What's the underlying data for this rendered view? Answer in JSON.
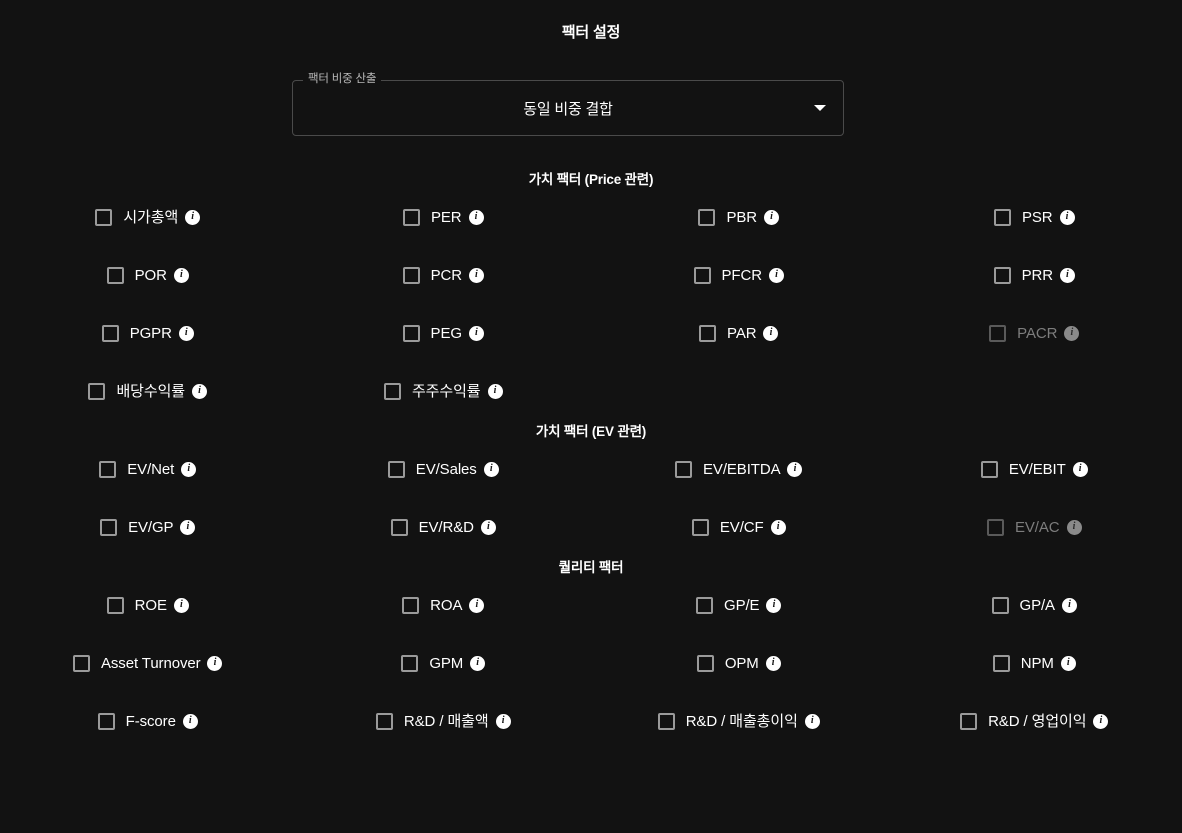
{
  "page": {
    "title": "팩터 설정",
    "background_color": "#121212",
    "text_color": "#ffffff",
    "disabled_color": "#7d7d7d"
  },
  "weight_select": {
    "legend": "팩터 비중 산출",
    "value": "동일 비중 결합",
    "arrow_icon": "chevron-down-icon"
  },
  "sections": [
    {
      "title": "가치 팩터 (Price 관련)",
      "rows": [
        [
          {
            "label": "시가총액",
            "checked": false,
            "disabled": false,
            "info_icon": "info-icon"
          },
          {
            "label": "PER",
            "checked": false,
            "disabled": false,
            "info_icon": "info-icon"
          },
          {
            "label": "PBR",
            "checked": false,
            "disabled": false,
            "info_icon": "info-icon"
          },
          {
            "label": "PSR",
            "checked": false,
            "disabled": false,
            "info_icon": "info-icon"
          }
        ],
        [
          {
            "label": "POR",
            "checked": false,
            "disabled": false,
            "info_icon": "info-icon"
          },
          {
            "label": "PCR",
            "checked": false,
            "disabled": false,
            "info_icon": "info-icon"
          },
          {
            "label": "PFCR",
            "checked": false,
            "disabled": false,
            "info_icon": "info-icon"
          },
          {
            "label": "PRR",
            "checked": false,
            "disabled": false,
            "info_icon": "info-icon"
          }
        ],
        [
          {
            "label": "PGPR",
            "checked": false,
            "disabled": false,
            "info_icon": "info-icon"
          },
          {
            "label": "PEG",
            "checked": false,
            "disabled": false,
            "info_icon": "info-icon"
          },
          {
            "label": "PAR",
            "checked": false,
            "disabled": false,
            "info_icon": "info-icon"
          },
          {
            "label": "PACR",
            "checked": false,
            "disabled": true,
            "info_icon": "info-icon"
          }
        ],
        [
          {
            "label": "배당수익률",
            "checked": false,
            "disabled": false,
            "info_icon": "info-icon"
          },
          {
            "label": "주주수익률",
            "checked": false,
            "disabled": false,
            "info_icon": "info-icon"
          },
          {
            "label": "",
            "empty": true
          },
          {
            "label": "",
            "empty": true
          }
        ]
      ]
    },
    {
      "title": "가치 팩터 (EV 관련)",
      "rows": [
        [
          {
            "label": "EV/Net",
            "checked": false,
            "disabled": false,
            "info_icon": "info-icon"
          },
          {
            "label": "EV/Sales",
            "checked": false,
            "disabled": false,
            "info_icon": "info-icon"
          },
          {
            "label": "EV/EBITDA",
            "checked": false,
            "disabled": false,
            "info_icon": "info-icon"
          },
          {
            "label": "EV/EBIT",
            "checked": false,
            "disabled": false,
            "info_icon": "info-icon"
          }
        ],
        [
          {
            "label": "EV/GP",
            "checked": false,
            "disabled": false,
            "info_icon": "info-icon"
          },
          {
            "label": "EV/R&D",
            "checked": false,
            "disabled": false,
            "info_icon": "info-icon"
          },
          {
            "label": "EV/CF",
            "checked": false,
            "disabled": false,
            "info_icon": "info-icon"
          },
          {
            "label": "EV/AC",
            "checked": false,
            "disabled": true,
            "info_icon": "info-icon"
          }
        ]
      ]
    },
    {
      "title": "퀄리티 팩터",
      "rows": [
        [
          {
            "label": "ROE",
            "checked": false,
            "disabled": false,
            "info_icon": "info-icon"
          },
          {
            "label": "ROA",
            "checked": false,
            "disabled": false,
            "info_icon": "info-icon"
          },
          {
            "label": "GP/E",
            "checked": false,
            "disabled": false,
            "info_icon": "info-icon"
          },
          {
            "label": "GP/A",
            "checked": false,
            "disabled": false,
            "info_icon": "info-icon"
          }
        ],
        [
          {
            "label": "Asset Turnover",
            "checked": false,
            "disabled": false,
            "info_icon": "info-icon"
          },
          {
            "label": "GPM",
            "checked": false,
            "disabled": false,
            "info_icon": "info-icon"
          },
          {
            "label": "OPM",
            "checked": false,
            "disabled": false,
            "info_icon": "info-icon"
          },
          {
            "label": "NPM",
            "checked": false,
            "disabled": false,
            "info_icon": "info-icon"
          }
        ],
        [
          {
            "label": "F-score",
            "checked": false,
            "disabled": false,
            "info_icon": "info-icon"
          },
          {
            "label": "R&D / 매출액",
            "checked": false,
            "disabled": false,
            "info_icon": "info-icon"
          },
          {
            "label": "R&D / 매출총이익",
            "checked": false,
            "disabled": false,
            "info_icon": "info-icon"
          },
          {
            "label": "R&D / 영업이익",
            "checked": false,
            "disabled": false,
            "info_icon": "info-icon"
          }
        ]
      ]
    }
  ]
}
